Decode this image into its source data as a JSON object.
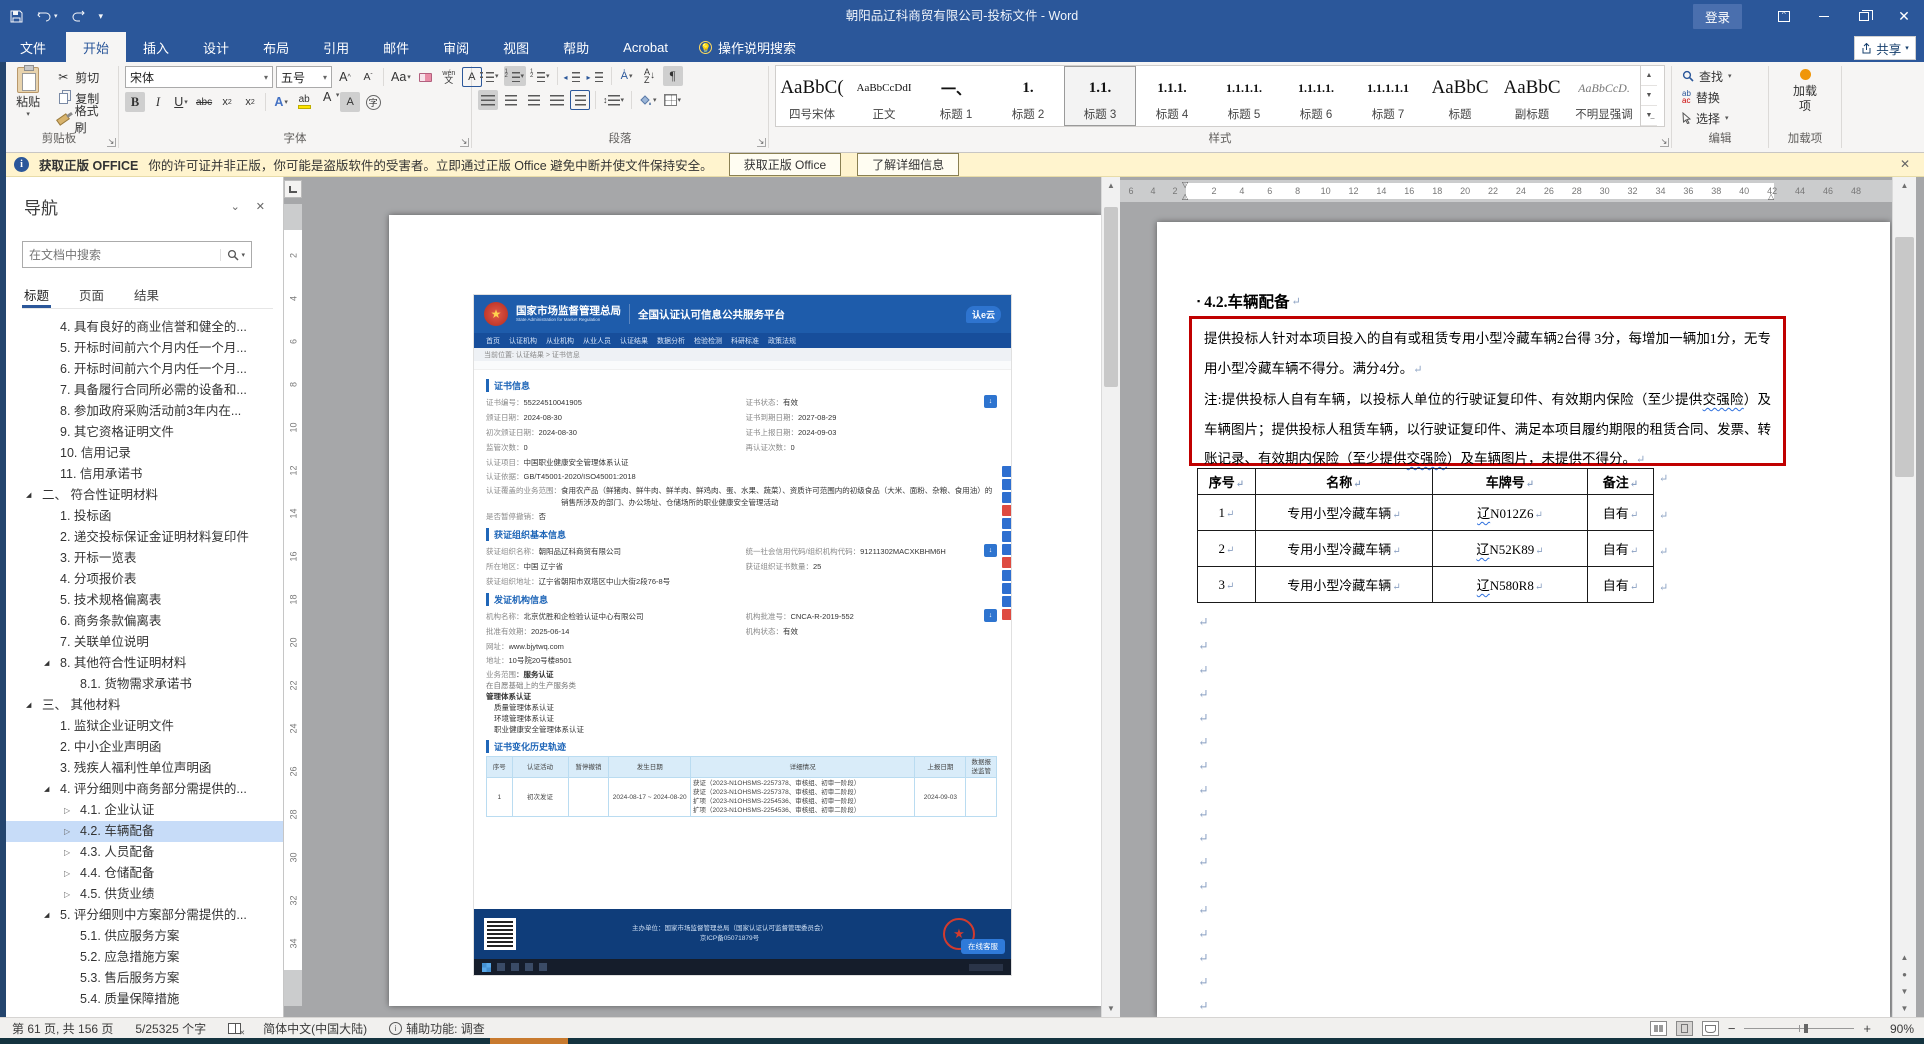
{
  "titlebar": {
    "title": "朝阳品辽科商贸有限公司-投标文件 -  Word",
    "signin": "登录",
    "share": "共享"
  },
  "tabs": {
    "file": "文件",
    "items": [
      {
        "label": "开始",
        "classes": "on"
      },
      {
        "label": "插入"
      },
      {
        "label": "设计"
      },
      {
        "label": "布局"
      },
      {
        "label": "引用"
      },
      {
        "label": "邮件"
      },
      {
        "label": "审阅"
      },
      {
        "label": "视图"
      },
      {
        "label": "帮助"
      },
      {
        "label": "Acrobat"
      }
    ],
    "tellme": "操作说明搜索"
  },
  "ribbon": {
    "paste": "粘贴",
    "cut": "剪切",
    "copy": "复制",
    "painter": "格式刷",
    "font_name": "宋体",
    "font_size": "五号",
    "styles": [
      {
        "preview": "AaBbC(",
        "label": "四号宋体",
        "classes": "p20"
      },
      {
        "preview": "AaBbCcDdI",
        "label": "正文",
        "classes": "p12"
      },
      {
        "preview": "一、",
        "label": "标题 1",
        "classes": "p15"
      },
      {
        "preview": "1.",
        "label": "标题 2",
        "classes": "p15"
      },
      {
        "preview": "1.1.",
        "label": "标题 3",
        "classes": "p15 sel"
      },
      {
        "preview": "1.1.1.",
        "label": "标题 4",
        "classes": "p14"
      },
      {
        "preview": "1.1.1.1.",
        "label": "标题 5",
        "classes": "p13"
      },
      {
        "preview": "1.1.1.1.",
        "label": "标题 6",
        "classes": "p13"
      },
      {
        "preview": "1.1.1.1.1",
        "label": "标题 7",
        "classes": "p13"
      },
      {
        "preview": "AaBbC",
        "label": "标题",
        "classes": "p20"
      },
      {
        "preview": "AaBbC",
        "label": "副标题",
        "classes": "p20"
      },
      {
        "preview": "AaBbCcD.",
        "label": "不明显强调",
        "classes": "p13 em"
      }
    ],
    "find": "查找",
    "replace": "替换",
    "select": "选择",
    "addins_label": "加载项",
    "groups": [
      {
        "label": "剪贴板"
      },
      {
        "label": "字体"
      },
      {
        "label": "段落"
      },
      {
        "label": "样式"
      },
      {
        "label": "编辑"
      },
      {
        "label": "加载项"
      }
    ]
  },
  "warnbar": {
    "title": "获取正版 OFFICE",
    "text": "你的许可证并非正版，你可能是盗版软件的受害者。立即通过正版 Office 避免中断并使文件保持安全。",
    "btn_get": "获取正版 Office",
    "btn_learn": "了解详细信息"
  },
  "nav": {
    "title": "导航",
    "search_placeholder": "在文档中搜索",
    "tabs": [
      {
        "label": "标题",
        "classes": "on"
      },
      {
        "label": "页面"
      },
      {
        "label": "结果"
      }
    ],
    "items": [
      {
        "label": "4. 具有良好的商业信誉和健全的...",
        "classes": "l2"
      },
      {
        "label": "5. 开标时间前六个月内任一个月...",
        "classes": "l2"
      },
      {
        "label": "6. 开标时间前六个月内任一个月...",
        "classes": "l2"
      },
      {
        "label": "7. 具备履行合同所必需的设备和...",
        "classes": "l2"
      },
      {
        "label": "8. 参加政府采购活动前3年内在...",
        "classes": "l2"
      },
      {
        "label": "9. 其它资格证明文件",
        "classes": "l2"
      },
      {
        "label": "10. 信用记录",
        "classes": "l2"
      },
      {
        "label": "11. 信用承诺书",
        "classes": "l2"
      },
      {
        "label": "二、 符合性证明材料",
        "classes": "l1 arrowD"
      },
      {
        "label": "1. 投标函",
        "classes": "l2"
      },
      {
        "label": "2. 递交投标保证金证明材料复印件",
        "classes": "l2"
      },
      {
        "label": "3. 开标一览表",
        "classes": "l2"
      },
      {
        "label": "4. 分项报价表",
        "classes": "l2"
      },
      {
        "label": "5. 技术规格偏离表",
        "classes": "l2"
      },
      {
        "label": "6. 商务条款偏离表",
        "classes": "l2"
      },
      {
        "label": "7. 关联单位说明",
        "classes": "l2"
      },
      {
        "label": "8. 其他符合性证明材料",
        "classes": "l2 arrowD"
      },
      {
        "label": "8.1. 货物需求承诺书",
        "classes": "l3"
      },
      {
        "label": "三、 其他材料",
        "classes": "l1 arrowD"
      },
      {
        "label": "1. 监狱企业证明文件",
        "classes": "l2"
      },
      {
        "label": "2. 中小企业声明函",
        "classes": "l2"
      },
      {
        "label": "3. 残疾人福利性单位声明函",
        "classes": "l2"
      },
      {
        "label": "4. 评分细则中商务部分需提供的...",
        "classes": "l2 arrowD"
      },
      {
        "label": "4.1. 企业认证",
        "classes": "l3 arrowR"
      },
      {
        "label": "4.2. 车辆配备",
        "classes": "l3 arrowR sel"
      },
      {
        "label": "4.3. 人员配备",
        "classes": "l3 arrowR"
      },
      {
        "label": "4.4. 仓储配备",
        "classes": "l3 arrowR"
      },
      {
        "label": "4.5. 供货业绩",
        "classes": "l3 arrowR"
      },
      {
        "label": "5. 评分细则中方案部分需提供的...",
        "classes": "l2 arrowD"
      },
      {
        "label": "5.1. 供应服务方案",
        "classes": "l3"
      },
      {
        "label": "5.2. 应急措施方案",
        "classes": "l3"
      },
      {
        "label": "5.3. 售后服务方案",
        "classes": "l3"
      },
      {
        "label": "5.4. 质量保障措施",
        "classes": "l3"
      }
    ]
  },
  "ruler": {
    "h_left": [
      "6",
      "4",
      "2"
    ],
    "h_mid": [
      "2",
      "4",
      "6",
      "8",
      "10",
      "12",
      "14",
      "16",
      "18",
      "20",
      "22",
      "24",
      "26",
      "28",
      "30",
      "32",
      "34",
      "36",
      "38",
      "40",
      "42"
    ],
    "h_right": [
      "44",
      "46",
      "48"
    ],
    "v": [
      "2",
      "4",
      "6",
      "8",
      "10",
      "12",
      "14",
      "16",
      "18",
      "20",
      "22",
      "24",
      "26",
      "28",
      "30",
      "32",
      "34"
    ]
  },
  "webshot": {
    "header": {
      "org": "国家市场监督管理总局",
      "org_en": "State Administration for Market Regulation",
      "platform": "全国认证认可信息公共服务平台",
      "logo": "认e云"
    },
    "menu": [
      "首页",
      "认证机构",
      "从业机构",
      "从业人员",
      "认证结果",
      "数据分析",
      "检验检测",
      "科研标准",
      "政策法规"
    ],
    "breadcrumb": "当前位置: 认证结果 > 证书信息",
    "cert": {
      "title": "证书信息",
      "fields": [
        {
          "l": "证书编号",
          "v": "55224510041905"
        },
        {
          "l": "证书状态",
          "v": "有效"
        },
        {
          "l": "颁证日期",
          "v": "2024-08-30"
        },
        {
          "l": "证书到期日期",
          "v": "2027-08-29"
        },
        {
          "l": "初次颁证日期",
          "v": "2024-08-30"
        },
        {
          "l": "证书上报日期",
          "v": "2024-09-03"
        },
        {
          "l": "监管次数",
          "v": "0"
        },
        {
          "l": "再认证次数",
          "v": "0"
        }
      ],
      "full": [
        {
          "l": "认证项目",
          "v": "中国职业健康安全管理体系认证"
        },
        {
          "l": "认证依据",
          "v": "GB/T45001-2020/ISO45001:2018"
        },
        {
          "l": "认证覆盖的业务范围",
          "v": "食用农产品（鲜猪肉、鲜牛肉、鲜羊肉、鲜鸡肉、蛋、水果、蔬菜）、资质许可范围内的初级食品（大米、面粉、杂粮、食用油）的销售所涉及的部门、办公场址、仓储场所的职业健康安全管理活动"
        },
        {
          "l": "是否暂停撤销",
          "v": "否"
        }
      ]
    },
    "org": {
      "title": "获证组织基本信息",
      "fields": [
        {
          "l": "获证组织名称",
          "v": "朝阳品辽科商贸有限公司"
        },
        {
          "l": "统一社会信用代码/组织机构代码",
          "v": "91211302MACXKBHM6H"
        },
        {
          "l": "所在地区",
          "v": "中国 辽宁省"
        },
        {
          "l": "获证组织证书数量",
          "v": "25"
        }
      ],
      "full": [
        {
          "l": "获证组织地址",
          "v": "辽宁省朝阳市双塔区中山大街2段76-8号"
        }
      ]
    },
    "issuer": {
      "title": "发证机构信息",
      "fields": [
        {
          "l": "机构名称",
          "v": "北京优胜和企检验认证中心有限公司"
        },
        {
          "l": "机构批准号",
          "v": "CNCA-R-2019-552"
        },
        {
          "l": "批准有效期",
          "v": "2025-06-14"
        },
        {
          "l": "机构状态",
          "v": "有效"
        }
      ],
      "full": [
        {
          "l": "网址",
          "v": "www.bjytwq.com"
        },
        {
          "l": "地址",
          "v": "10号院20号楼8501"
        }
      ],
      "scope_label": "业务范围",
      "scope_service": "服务认证",
      "scope_line": "在自愿基础上的生产服务类",
      "scope_mgmt": "管理体系认证",
      "scope_items": [
        "质量管理体系认证",
        "环境管理体系认证",
        "职业健康安全管理体系认证"
      ]
    },
    "history": {
      "title": "证书变化历史轨迹",
      "headers": [
        "序号",
        "认证活动",
        "暂停撤销",
        "发生日期",
        "详细情况",
        "上报日期",
        "数据报送监管"
      ],
      "row": {
        "no": "1",
        "activity": "初次发证",
        "pause": "",
        "date": "2024-08-17 ~ 2024-08-20",
        "details": [
          "获证（2023-N1OHSMS-2257378、审核组、初审一阶段）",
          "获证（2023-N1OHSMS-2257378、审核组、初审二阶段）",
          "扩项（2023-N1OHSMS-2254536、审核组、初审一阶段）",
          "扩项（2023-N1OHSMS-2254536、审核组、初审二阶段）"
        ],
        "report": "2024-09-03"
      }
    },
    "footer": {
      "line1": "主办单位：国家市场监督管理总局（国家认证认可监督管理委员会）",
      "line2": "京ICP备05071879号",
      "service": "在线客服"
    }
  },
  "doc": {
    "heading": "4.2.车辆配备",
    "para1": "提供投标人针对本项目投入的自有或租赁专用小型冷藏车辆2台得 3分，每增加一辆加1分，无专用小型冷藏车辆不得分。满分4分。",
    "para2_parts": [
      {
        "t": "注:提供投标人自有车辆，以投标人单位的行驶证复印件、有效期内保险（至少提供"
      },
      {
        "t": "交强险",
        "classes": "wavy"
      },
      {
        "t": "）及车辆图片；提供投标人租赁车辆，以行驶证复印件、满足本项目履约期限的租赁合同、发票、转账记录、有效期内保险（至少提供"
      },
      {
        "t": "交强险",
        "classes": "wavy"
      },
      {
        "t": "）及车辆图片，未提供不得分。"
      }
    ],
    "table": {
      "headers": [
        "序号",
        "名称",
        "车牌号",
        "备注"
      ],
      "rows": [
        {
          "no": "1",
          "name": "专用小型冷藏车辆",
          "prefix": "辽",
          "plate": "N012Z6",
          "note": "自有"
        },
        {
          "no": "2",
          "name": "专用小型冷藏车辆",
          "prefix": "辽",
          "plate": "N52K89",
          "note": "自有"
        },
        {
          "no": "3",
          "name": "专用小型冷藏车辆",
          "prefix": "辽",
          "plate": "N580R8",
          "note": "自有"
        }
      ]
    },
    "marks": [
      "↵",
      "↵",
      "↵",
      "↵",
      "↵",
      "↵",
      "↵",
      "↵",
      "↵",
      "↵",
      "↵",
      "↵",
      "↵",
      "↵",
      "↵",
      "↵",
      "↵"
    ]
  },
  "statusbar": {
    "page": "第 61 页, 共 156 页",
    "words": "5/25325 个字",
    "lang": "简体中文(中国大陆)",
    "acc": "辅助功能: 调查",
    "zoom": "90%"
  }
}
